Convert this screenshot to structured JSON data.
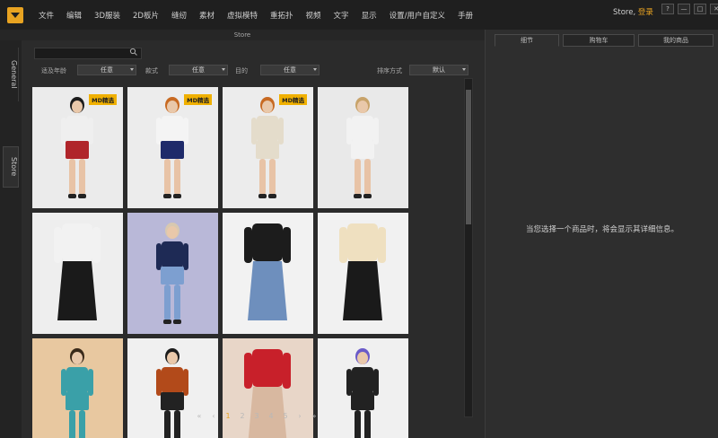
{
  "menubar": {
    "items": [
      "文件",
      "编辑",
      "3D服装",
      "2D板片",
      "缝纫",
      "素材",
      "虚拟模特",
      "重拓扑",
      "视频",
      "文字",
      "显示",
      "设置/用户自定义",
      "手册"
    ],
    "store_label": "Store,",
    "login_label": "登录",
    "window_buttons": [
      "?",
      "—",
      "□",
      "✕"
    ]
  },
  "panel_title": "Store",
  "side_tabs": {
    "general": "General",
    "store": "Store"
  },
  "filters": {
    "age_label": "适及年龄",
    "age_value": "任意",
    "style_label": "款式",
    "style_value": "任意",
    "purpose_label": "目的",
    "purpose_value": "任意",
    "sort_label": "排序方式",
    "sort_value": "默认"
  },
  "cards": [
    {
      "badge": "MD精选",
      "bg": "#ebebeb",
      "hair": "#1c1c1c",
      "top": "#efefef",
      "bottom": "#b0252a",
      "legs": "#e8c3a6"
    },
    {
      "badge": "MD精选",
      "bg": "#ececec",
      "hair": "#c86a22",
      "top": "#f4f4f4",
      "bottom": "#1f2a6a",
      "legs": "#e8c3a6"
    },
    {
      "badge": "MD精选",
      "bg": "#ececec",
      "hair": "#c86a22",
      "top": "#e4dccb",
      "bottom": "#e4dccb",
      "legs": "#e8c3a6"
    },
    {
      "badge": "",
      "bg": "#e9e9e9",
      "hair": "#c8a36a",
      "top": "#f2f2f2",
      "bottom": "#f2f2f2",
      "legs": "#e8c3a6"
    },
    {
      "badge": "",
      "bg": "#eeeeee",
      "hair": "",
      "top": "#f2f2f2",
      "bottom": "#1a1a1a",
      "legs": ""
    },
    {
      "badge": "",
      "bg": "#b9b8d8",
      "hair": "#d8c8b0",
      "top": "#1e2a55",
      "bottom": "#7d9fd0",
      "legs": ""
    },
    {
      "badge": "",
      "bg": "#f2f2f2",
      "hair": "",
      "top": "#1c1c1c",
      "bottom": "#6e8fbd",
      "legs": ""
    },
    {
      "badge": "",
      "bg": "#f1f1f1",
      "hair": "",
      "top": "#efe0c0",
      "bottom": "#1a1a1a",
      "legs": ""
    },
    {
      "badge": "",
      "bg": "#e8c8a0",
      "hair": "#3a2a1a",
      "top": "#3aa0a8",
      "bottom": "#3aa0a8",
      "legs": ""
    },
    {
      "badge": "",
      "bg": "#f0f0f0",
      "hair": "#1c1c1c",
      "top": "#b24a1a",
      "bottom": "#222222",
      "legs": ""
    },
    {
      "badge": "",
      "bg": "#e8d6c8",
      "hair": "",
      "top": "#c8202a",
      "bottom": "#d8b8a0",
      "legs": ""
    },
    {
      "badge": "",
      "bg": "#f0f0f0",
      "hair": "#6a5ac8",
      "top": "#222222",
      "bottom": "#222222",
      "legs": ""
    }
  ],
  "pager": {
    "first": "«",
    "prev": "‹",
    "pages": [
      "1",
      "2",
      "3",
      "4",
      "5"
    ],
    "next": "›",
    "last": "»",
    "current": "1"
  },
  "right_panel": {
    "tabs": [
      "细节",
      "购物车",
      "我的商品"
    ],
    "message": "当您选择一个商品时，将会显示其详细信息。"
  },
  "colors": {
    "accent": "#e8a321",
    "badge": "#f0b000"
  }
}
